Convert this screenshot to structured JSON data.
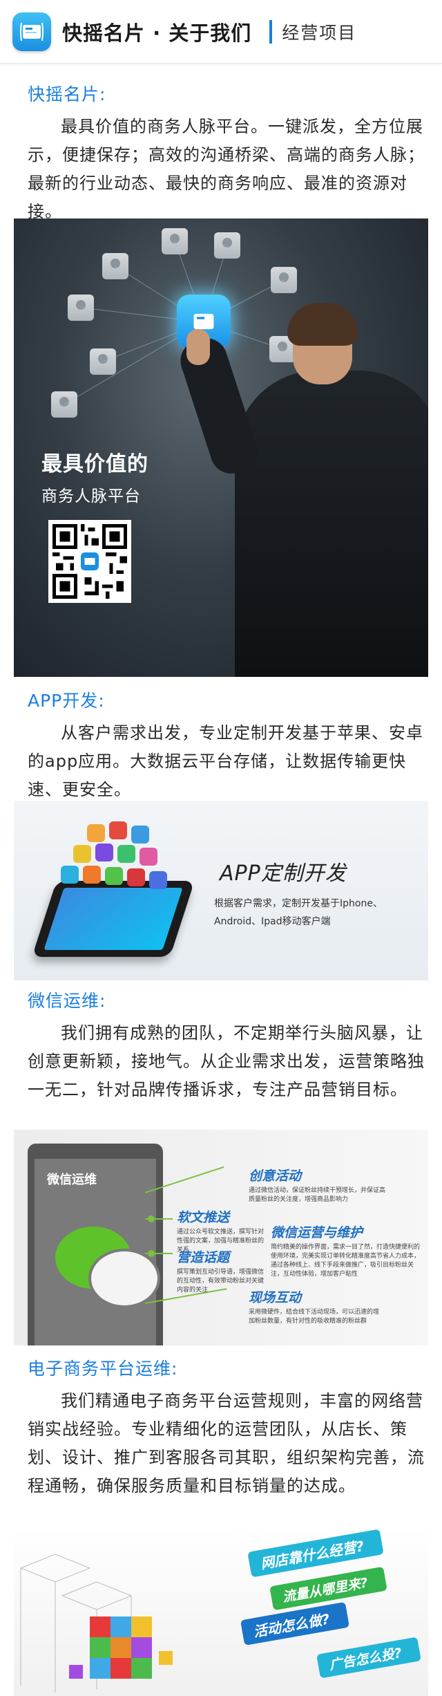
{
  "header": {
    "title": "快摇名片 · 关于我们",
    "subnav": "经营项目",
    "icon": "card-app-icon"
  },
  "sections": {
    "card": {
      "title": "快摇名片:",
      "text": "最具价值的商务人脉平台。一键派发，全方位展示，便捷保存；高效的沟通桥梁、高端的商务人脉；最新的行业动态、最快的商务响应、最准的资源对接。"
    },
    "app": {
      "title": "APP开发:",
      "text": "从客户需求出发，专业定制开发基于苹果、安卓的app应用。大数据云平台存储，让数据传输更快速、更安全。"
    },
    "wechat": {
      "title": "微信运维:",
      "text": "我们拥有成熟的团队，不定期举行头脑风暴，让创意更新颖，接地气。从企业需求出发，运营策略独一无二，针对品牌传播诉求，专注产品营销目标。"
    },
    "ecommerce": {
      "title": "电子商务平台运维:",
      "text": "我们精通电子商务平台运营规则，丰富的网络营销实战经验。专业精细化的运营团队，从店长、策划、设计、推广到客服各司其职，组织架构完善，流程通畅，确保服务质量和目标销量的达成。"
    }
  },
  "hero": {
    "caption_line1": "最具价值的",
    "caption_line2": "商务人脉平台"
  },
  "app_banner": {
    "title": "APP定制开发",
    "desc_line1": "根据客户需求，定制开发基于Iphone、",
    "desc_line2": "Android、Ipad移动客户端"
  },
  "wx_banner": {
    "screen_title": "微信运维",
    "items": [
      {
        "title": "创意活动",
        "desc": "通过微信活动，保证粉丝持续干预增长，并保证高质量粉丝的关注度，增强商品影响力"
      },
      {
        "title": "软文推送",
        "desc": "通过公众号软文推送，撰写针对性强的文案，加强与精准粉丝的关系"
      },
      {
        "title": "微信运营与维护",
        "desc": "简约精美的操作界面，需求一目了然，打造快捷便利的使用环境，完美实现订单转化精准度高节省人力成本，通过各种线上、线下手段来做推广，吸引目标粉丝关注，互动性体验，增加客户粘性"
      },
      {
        "title": "营造话题",
        "desc": "撰写策划互动引导语，增强微信的互动性，有效带动粉丝对关键内容的关注"
      },
      {
        "title": "现场互动",
        "desc": "采用微硬件，结合线下活动现场，可以迅速的增加粉丝数量，有针对性的吸收精准的粉丝群"
      }
    ]
  },
  "ec_banner": {
    "ribbon1": "网店靠什么经营?",
    "ribbon2": "流量从哪里来?",
    "ribbon3": "活动怎么做?",
    "ribbon4": "广告怎么投?"
  },
  "colors": {
    "accent": "#1a7fe0",
    "wx_green": "#7bc142"
  }
}
